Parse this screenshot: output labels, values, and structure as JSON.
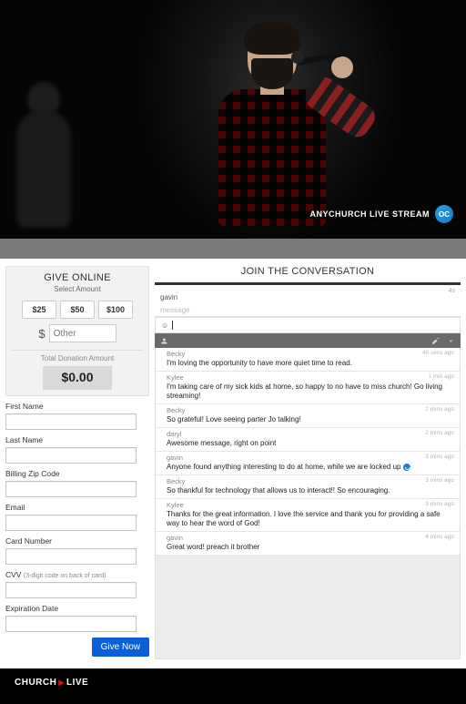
{
  "video": {
    "overlay_label": "ANYCHURCH LIVE STREAM",
    "badge_text": "OC"
  },
  "give": {
    "title": "GIVE ONLINE",
    "subtitle": "Select Amount",
    "amounts": [
      "$25",
      "$50",
      "$100"
    ],
    "currency_symbol": "$",
    "other_placeholder": "Other",
    "total_label": "Total Donation Amount",
    "total_value": "$0.00",
    "fields": {
      "first_name": "First Name",
      "last_name": "Last Name",
      "zip": "Billing Zip Code",
      "email": "Email",
      "card": "Card Number",
      "cvv": "CVV",
      "cvv_hint": "(3-digit code on back of card)",
      "exp": "Expiration Date"
    },
    "submit": "Give Now"
  },
  "chat": {
    "title": "JOIN THE CONVERSATION",
    "my_name": "gavin",
    "my_age": "4s",
    "placeholder": "message",
    "compose_icon": "☺",
    "messages": [
      {
        "user": "Becky",
        "time": "40 secs ago",
        "body": "I'm loving the opportunity to have more quiet time to read."
      },
      {
        "user": "Kylee",
        "time": "1 min ago",
        "body": "I'm taking care of my sick kids at home, so happy to no have to miss church! Go living streaming!"
      },
      {
        "user": "Becky",
        "time": "2 mins ago",
        "body": "So grateful! Love seeing parter Jo talking!"
      },
      {
        "user": "daryl",
        "time": "2 mins ago",
        "body": "Awesome message, right on point"
      },
      {
        "user": "gavin",
        "time": "3 mins ago",
        "body": "Anyone found anything interesting to do at home, while we are locked up",
        "emoji": true
      },
      {
        "user": "Becky",
        "time": "3 mins ago",
        "body": "So thankful for technology that allows us to interact!! So encouraging."
      },
      {
        "user": "Kylee",
        "time": "3 mins ago",
        "body": "Thanks for the great information. I love the service and thank you for providing a safe way to hear the word of God!"
      },
      {
        "user": "gavin",
        "time": "4 mins ago",
        "body": "Great word! preach it brother"
      }
    ]
  },
  "footer": {
    "brand_left": "CHURCH",
    "brand_right": "LIVE"
  }
}
